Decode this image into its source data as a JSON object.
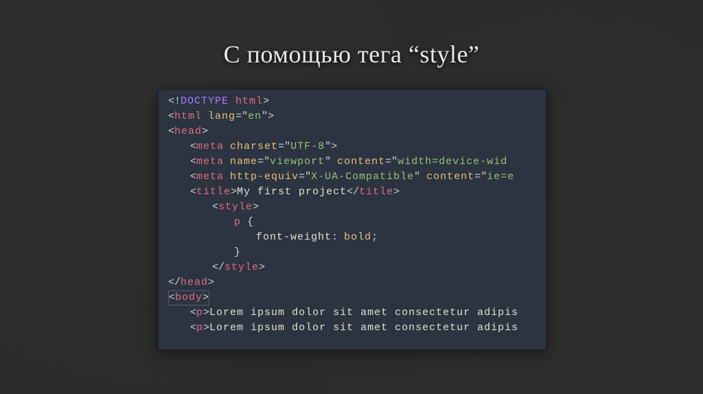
{
  "slide": {
    "title": "С помощью тега “style”"
  },
  "code": {
    "doctype_kw": "DOCTYPE",
    "doctype_val": "html",
    "html_tag": "html",
    "html_attr_lang": "lang",
    "html_attr_lang_val": "en",
    "head_tag": "head",
    "meta_tag": "meta",
    "attr_charset": "charset",
    "val_charset": "UTF-8",
    "attr_name": "name",
    "val_viewport": "viewport",
    "attr_content": "content",
    "val_content_viewport": "width=device-wid",
    "attr_http_equiv": "http-equiv",
    "val_http_equiv": "X-UA-Compatible",
    "val_content_ie": "ie=e",
    "title_tag": "title",
    "title_text": "My first project",
    "style_tag": "style",
    "css_selector": "p",
    "css_open_brace": "{",
    "css_prop": "font-weight",
    "css_colon": ":",
    "css_value": "bold",
    "css_semicolon": ";",
    "css_close_brace": "}",
    "body_tag": "body",
    "p_tag": "p",
    "lorem1": "Lorem ipsum dolor sit amet consectetur adipis",
    "lorem2": "Lorem ipsum dolor sit amet consectetur adipis"
  }
}
